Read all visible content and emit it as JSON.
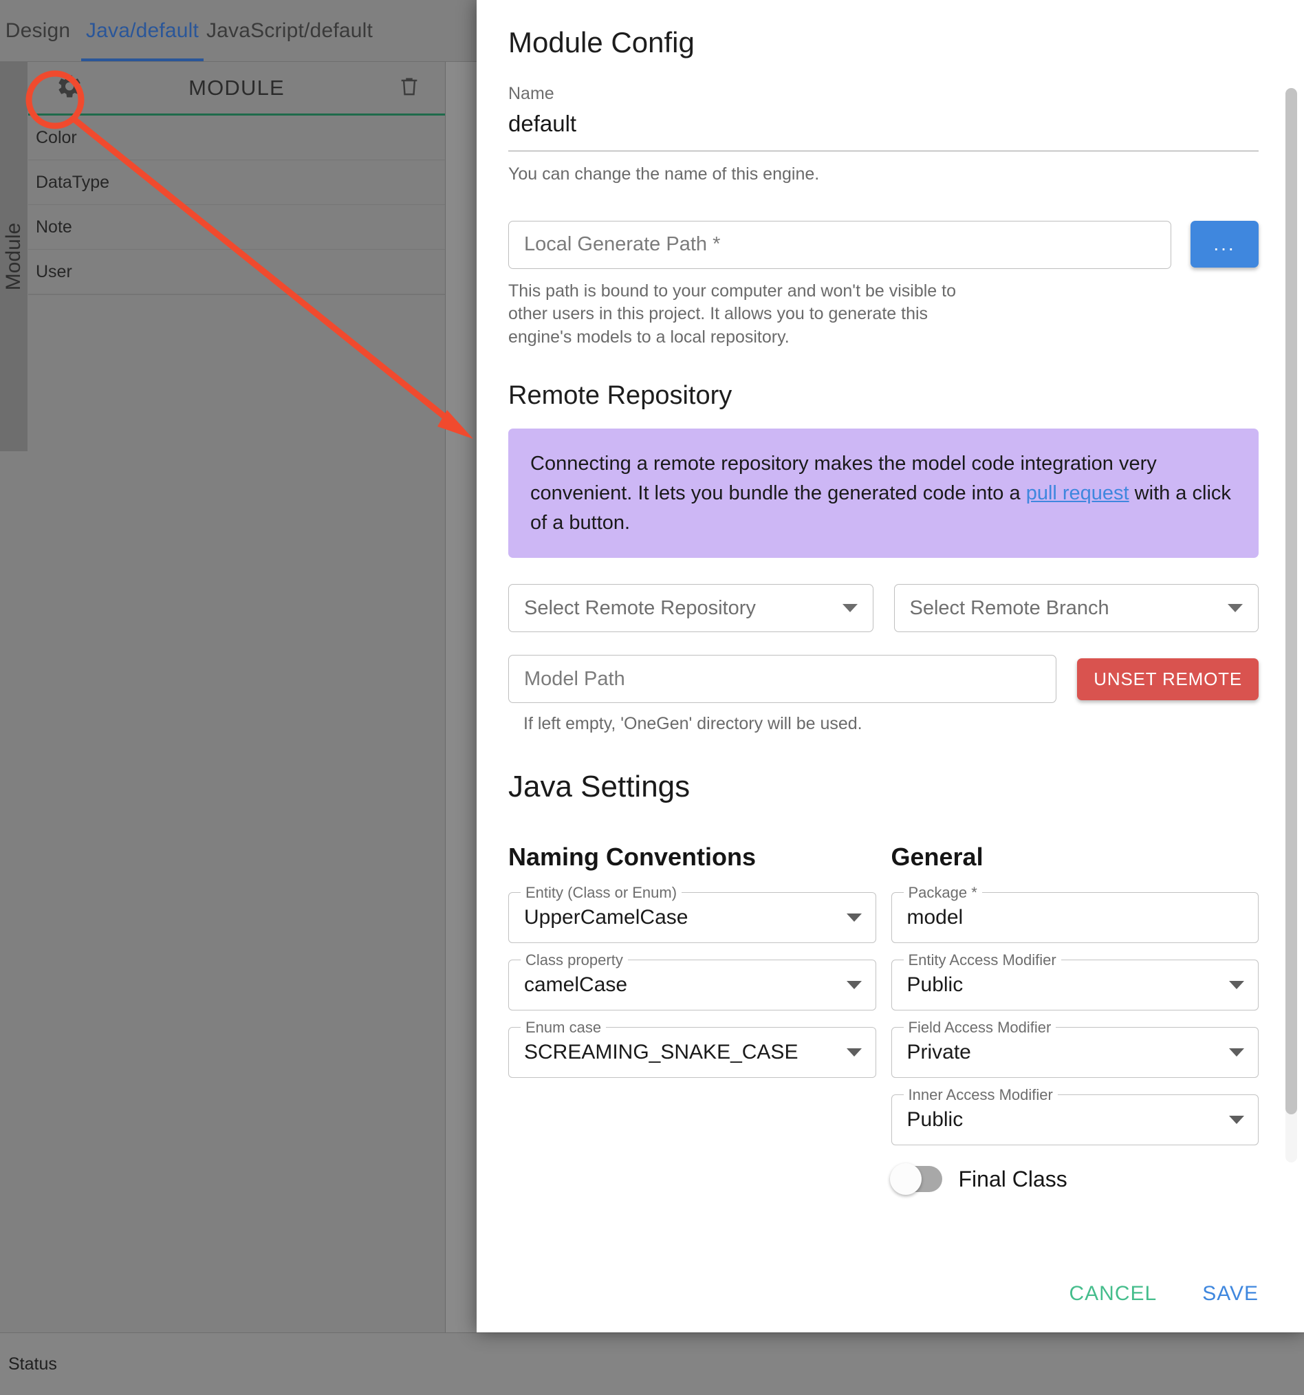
{
  "tabs": [
    {
      "label": "Design",
      "active": false
    },
    {
      "label": "Java/default",
      "active": true
    },
    {
      "label": "JavaScript/default",
      "active": false
    }
  ],
  "side_strip": {
    "label": "Module"
  },
  "module_panel": {
    "title": "MODULE",
    "gear_icon": "gear-icon",
    "delete_icon": "trash-icon",
    "rows": [
      "Color",
      "DataType",
      "Note",
      "User"
    ]
  },
  "statusbar": {
    "label": "Status"
  },
  "dialog": {
    "title": "Module Config",
    "name": {
      "label": "Name",
      "value": "default",
      "helper": "You can change the name of this engine."
    },
    "local_path": {
      "placeholder": "Local Generate Path *",
      "browse_button": "...",
      "helper": "This path is bound to your computer and won't be visible to other users in this project. It allows you to generate this engine's models to a local repository."
    },
    "remote": {
      "heading": "Remote Repository",
      "notice_part1": "Connecting a remote repository makes the model code integration very convenient. It lets you bundle the generated code into a ",
      "notice_link": "pull request",
      "notice_part2": " with a click of a button.",
      "repo_select": "Select Remote Repository",
      "branch_select": "Select Remote Branch",
      "model_path_placeholder": "Model Path",
      "unset_button": "UNSET REMOTE",
      "model_path_helper": "If left empty, 'OneGen' directory will be used."
    },
    "java_settings": {
      "heading": "Java Settings",
      "naming": {
        "heading": "Naming Conventions",
        "fields": [
          {
            "legend": "Entity (Class or Enum)",
            "value": "UpperCamelCase"
          },
          {
            "legend": "Class property",
            "value": "camelCase"
          },
          {
            "legend": "Enum case",
            "value": "SCREAMING_SNAKE_CASE"
          }
        ]
      },
      "general": {
        "heading": "General",
        "fields": [
          {
            "legend": "Package *",
            "value": "model",
            "type": "text"
          },
          {
            "legend": "Entity Access Modifier",
            "value": "Public",
            "type": "select"
          },
          {
            "legend": "Field Access Modifier",
            "value": "Private",
            "type": "select"
          },
          {
            "legend": "Inner Access Modifier",
            "value": "Public",
            "type": "select"
          }
        ],
        "toggle": {
          "label": "Final Class",
          "on": false
        }
      }
    },
    "footer": {
      "cancel": "CANCEL",
      "save": "SAVE"
    }
  },
  "colors": {
    "accent_blue": "#3f87de",
    "tab_active": "#2a5699",
    "notice_bg": "#cdb7f5",
    "danger": "#d9534f",
    "cancel_green": "#45bd8c",
    "annotation_red": "#f04a2e",
    "module_underline": "#1f6b4b"
  }
}
